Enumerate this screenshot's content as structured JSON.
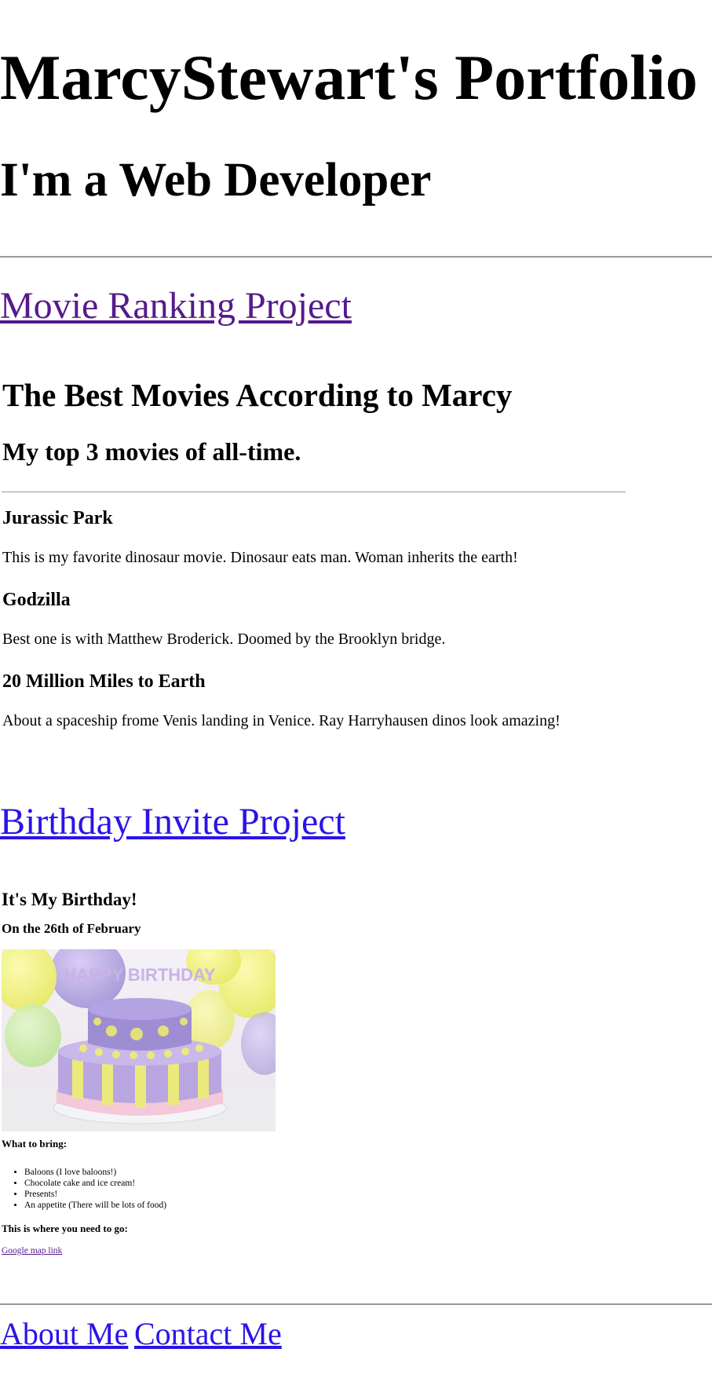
{
  "header": {
    "title": "MarcyStewart's Portfolio",
    "subtitle": "I'm a Web Developer"
  },
  "projects": {
    "movie": {
      "link_label": "Movie Ranking Project",
      "heading": "The Best Movies According to Marcy",
      "subheading": "My top 3 movies of all-time.",
      "movies": [
        {
          "title": "Jurassic Park",
          "description": "This is my favorite dinosaur movie. Dinosaur eats man. Woman inherits the earth!"
        },
        {
          "title": "Godzilla",
          "description": "Best one is with Matthew Broderick. Doomed by the Brooklyn bridge."
        },
        {
          "title": "20 Million Miles to Earth",
          "description": "About a spaceship frome Venis landing in Venice. Ray Harryhausen dinos look amazing!"
        }
      ]
    },
    "birthday": {
      "link_label": "Birthday Invite Project",
      "heading": "It's My Birthday!",
      "date": "On the 26th of February",
      "cake_text": "HAPPY BIRTHDAY",
      "bring_label": "What to bring:",
      "bring_items": [
        "Baloons (I love baloons!)",
        "Chocolate cake and ice cream!",
        "Presents!",
        "An appetite (There will be lots of food)"
      ],
      "go_label": "This is where you need to go:",
      "map_link": "Google map link"
    }
  },
  "footer": {
    "about": "About Me",
    "contact": "Contact Me"
  },
  "colors": {
    "visited_link": "#551a8b",
    "link": "#2a14e8",
    "rule": "#9a9a9a"
  }
}
